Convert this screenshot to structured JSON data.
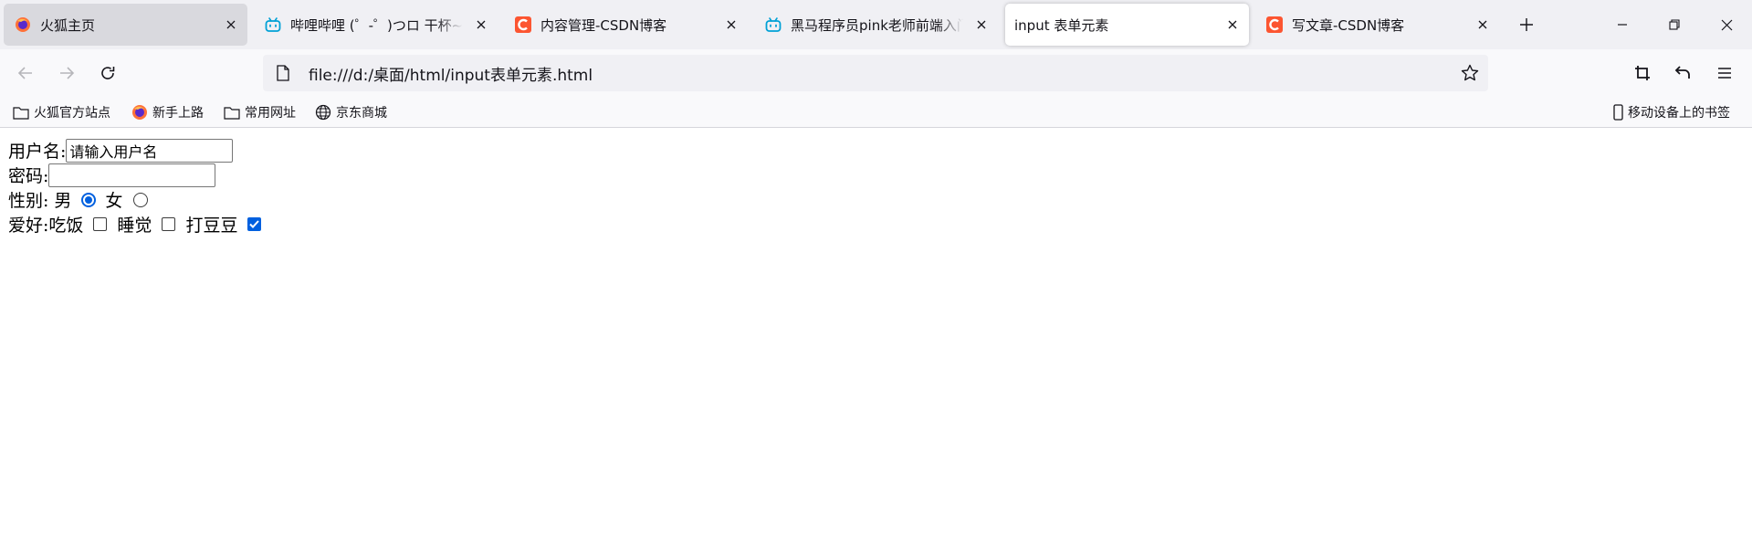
{
  "tabs": [
    {
      "title": "火狐主页",
      "icon": "firefox-icon",
      "state": "hovered"
    },
    {
      "title": "哔哩哔哩 (゜-゜)つロ 干杯~-bilibili",
      "icon": "bilibili-icon",
      "state": "normal"
    },
    {
      "title": "内容管理-CSDN博客",
      "icon": "csdn-icon",
      "state": "normal"
    },
    {
      "title": "黑马程序员pink老师前端入门教程",
      "icon": "bilibili-icon",
      "state": "normal"
    },
    {
      "title": "input 表单元素",
      "icon": "none",
      "state": "selected"
    },
    {
      "title": "写文章-CSDN博客",
      "icon": "csdn-icon",
      "state": "normal"
    }
  ],
  "toolbar": {
    "url": "file:///d:/桌面/html/input表单元素.html"
  },
  "bookmarks": {
    "items": [
      {
        "label": "火狐官方站点",
        "icon": "folder-icon"
      },
      {
        "label": "新手上路",
        "icon": "firefox-icon"
      },
      {
        "label": "常用网址",
        "icon": "folder-icon"
      },
      {
        "label": "京东商城",
        "icon": "globe-icon"
      }
    ],
    "mobile": {
      "label": "移动设备上的书签",
      "icon": "mobile-icon"
    }
  },
  "form": {
    "username_label": "用户名:",
    "username_value": "请输入用户名",
    "password_label": "密码:",
    "password_value": "",
    "gender_label": "性别:",
    "gender_options": [
      {
        "label": "男",
        "checked": true
      },
      {
        "label": "女",
        "checked": false
      }
    ],
    "hobby_label": "爱好:",
    "hobby_options": [
      {
        "label": "吃饭",
        "checked": false
      },
      {
        "label": "睡觉",
        "checked": false
      },
      {
        "label": "打豆豆",
        "checked": true
      }
    ]
  },
  "colors": {
    "accent": "#0060df",
    "tabstrip": "#f0f0f4",
    "csdn": "#fc5531",
    "bilibili": "#00a1d6"
  }
}
